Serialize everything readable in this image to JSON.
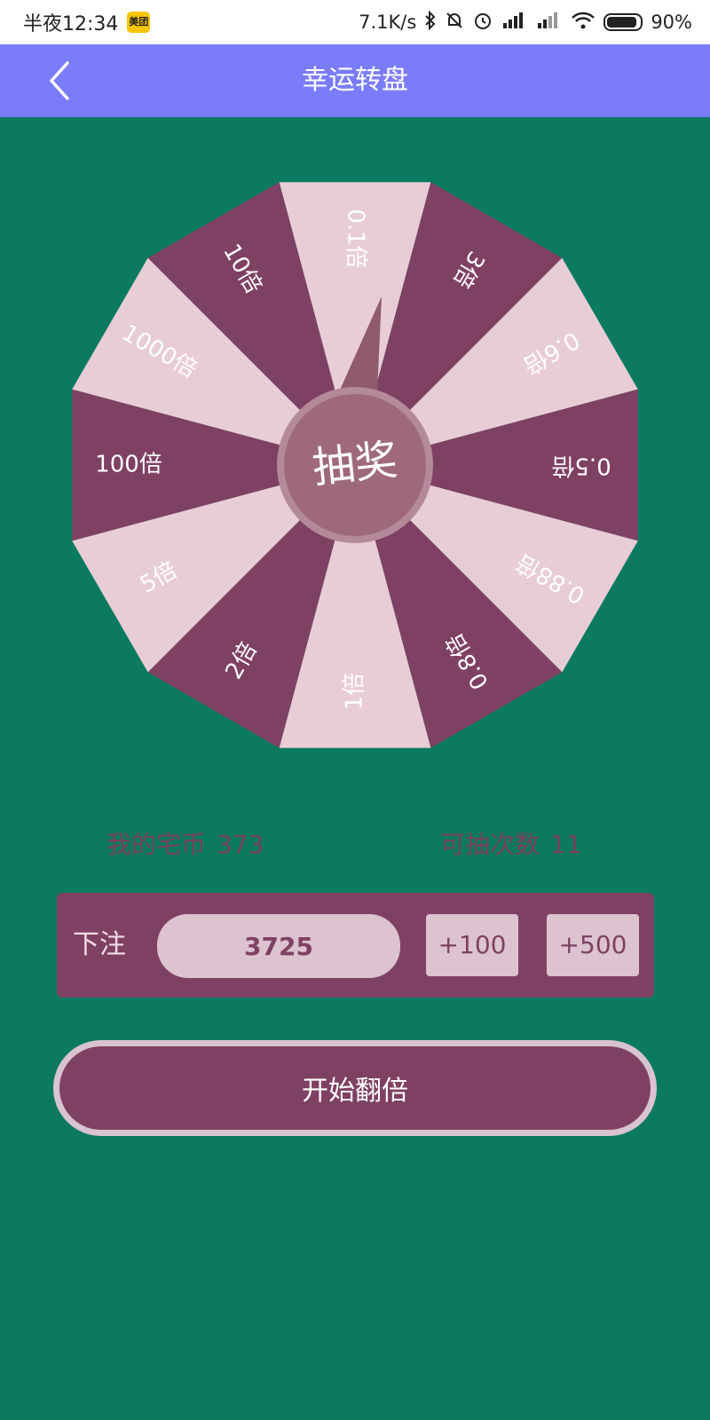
{
  "status_bar": {
    "time": "半夜12:34",
    "app_badge": "美团",
    "net_speed": "7.1K/s",
    "battery": "90%",
    "icons": [
      "bluetooth-icon",
      "mute-bell-icon",
      "alarm-icon",
      "signal-hd-icon",
      "signal-hd-icon",
      "wifi-icon",
      "battery-icon"
    ]
  },
  "header": {
    "title": "幸运转盘",
    "back_icon": "chevron-left-icon"
  },
  "wheel": {
    "center_label": "抽奖",
    "segments": [
      "0.1倍",
      "3倍",
      "0.6倍",
      "0.5倍",
      "0.88倍",
      "0.8倍",
      "1倍",
      "2倍",
      "5倍",
      "100倍",
      "1000倍",
      "10倍"
    ],
    "colors": {
      "dark": "#7f4163",
      "light": "#e8cdd7",
      "center": "#9e6a7a",
      "pointer": "#8f5a6c"
    }
  },
  "info": {
    "coins_label": "我的宅币",
    "coins_value": "373",
    "draws_label": "可抽次数",
    "draws_value": "11"
  },
  "bet": {
    "label": "下注",
    "value": "3725",
    "add_100_label": "+100",
    "add_500_label": "+500"
  },
  "start_button_label": "开始翻倍",
  "colors": {
    "background": "#0b7a60",
    "title_bar": "#7b7cf9",
    "panel": "#7f4163",
    "panel_light": "#dcc3cf"
  }
}
